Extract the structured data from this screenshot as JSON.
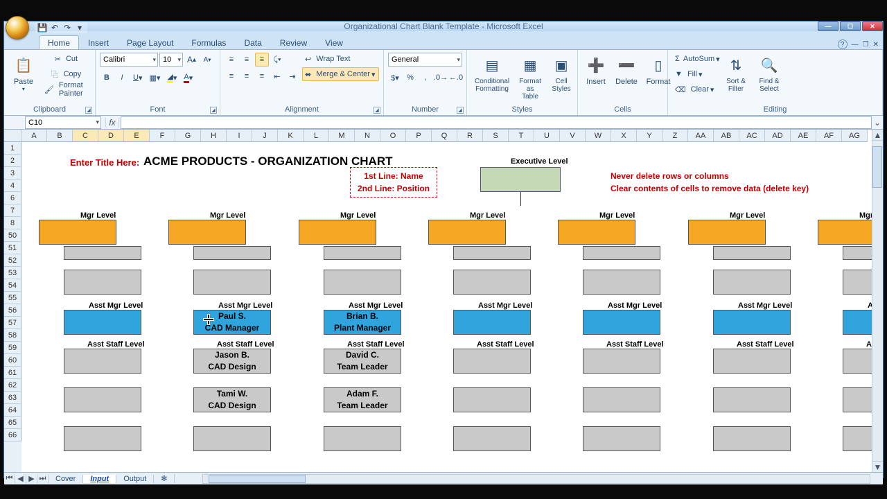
{
  "window": {
    "title": "Organizational Chart Blank Template - Microsoft Excel"
  },
  "tabs": {
    "home": "Home",
    "insert": "Insert",
    "pagelayout": "Page Layout",
    "formulas": "Formulas",
    "data": "Data",
    "review": "Review",
    "view": "View"
  },
  "ribbon": {
    "clipboard": {
      "paste": "Paste",
      "cut": "Cut",
      "copy": "Copy",
      "fpainter": "Format Painter",
      "label": "Clipboard"
    },
    "font": {
      "name": "Calibri",
      "size": "10",
      "label": "Font"
    },
    "alignment": {
      "wrap": "Wrap Text",
      "merge": "Merge & Center",
      "label": "Alignment"
    },
    "number": {
      "format": "General",
      "label": "Number"
    },
    "styles": {
      "cond": "Conditional Formatting",
      "table": "Format as Table",
      "cell": "Cell Styles",
      "label": "Styles"
    },
    "cells": {
      "insert": "Insert",
      "delete": "Delete",
      "format": "Format",
      "label": "Cells"
    },
    "editing": {
      "autosum": "AutoSum",
      "fill": "Fill",
      "clear": "Clear",
      "sort": "Sort & Filter",
      "find": "Find & Select",
      "label": "Editing"
    }
  },
  "namebox": "C10",
  "columns": [
    "A",
    "B",
    "C",
    "D",
    "E",
    "F",
    "G",
    "H",
    "I",
    "J",
    "K",
    "L",
    "M",
    "N",
    "O",
    "P",
    "Q",
    "R",
    "S",
    "T",
    "U",
    "V",
    "W",
    "X",
    "Y",
    "Z",
    "AA",
    "AB",
    "AC",
    "AD",
    "AE",
    "AF",
    "AG"
  ],
  "rows_top": [
    "1",
    "2",
    "3",
    "4",
    "6",
    "7",
    "8"
  ],
  "rows_bottom": [
    "50",
    "51",
    "52",
    "53",
    "54",
    "55",
    "56",
    "57",
    "58",
    "59",
    "60",
    "61",
    "62",
    "63",
    "64",
    "65",
    "66"
  ],
  "sheet": {
    "enter_title": "Enter Title Here:",
    "main_title": "ACME PRODUCTS - ORGANIZATION CHART",
    "legend_l1": "1st Line: Name",
    "legend_l2": "2nd Line: Position",
    "exec_label": "Executive Level",
    "warn1": "Never delete rows or columns",
    "warn2": "Clear contents of cells to remove data (delete key)",
    "mgr_label": "Mgr Level",
    "asst_mgr_label": "Asst Mgr Level",
    "asst_staff_label": "Asst Staff Level",
    "col2_mgr_name": "Paul S.",
    "col2_mgr_pos": "CAD Manager",
    "col2_s1_name": "Jason B.",
    "col2_s1_pos": "CAD Design",
    "col2_s2_name": "Tami W.",
    "col2_s2_pos": "CAD Design",
    "col3_mgr_name": "Brian B.",
    "col3_mgr_pos": "Plant Manager",
    "col3_s1_name": "David C.",
    "col3_s1_pos": "Team Leader",
    "col3_s2_name": "Adam F.",
    "col3_s2_pos": "Team Leader"
  },
  "sheets": {
    "s1": "Cover",
    "s2": "Input",
    "s3": "Output"
  }
}
